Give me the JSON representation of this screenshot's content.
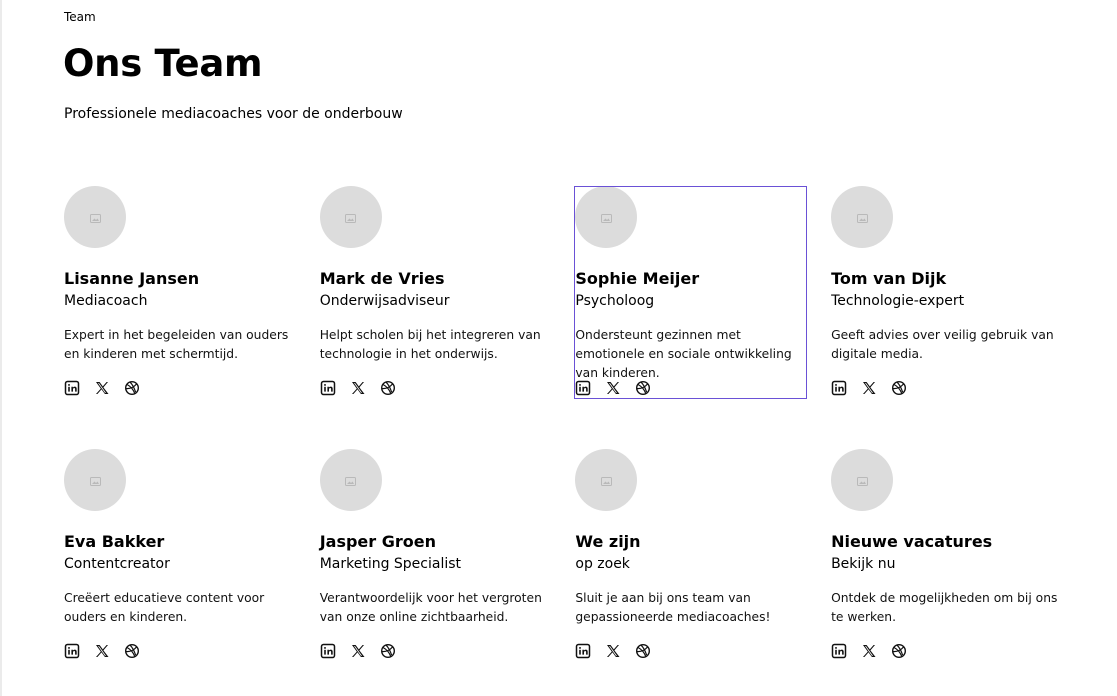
{
  "page": {
    "eyebrow": "Team",
    "title": "Ons Team",
    "subtitle": "Professionele mediacoaches voor de onderbouw"
  },
  "colors": {
    "avatar_bg": "#dcdcdc",
    "selection_outline": "#6a51d6"
  },
  "icons": {
    "avatar": "image-placeholder-icon",
    "socials": [
      "linkedin-icon",
      "x-icon",
      "dribbble-icon"
    ]
  },
  "members": [
    {
      "name": "Lisanne Jansen",
      "role": "Mediacoach",
      "bio": "Expert in het begeleiden van ouders en kinderen met schermtijd."
    },
    {
      "name": "Mark de Vries",
      "role": "Onderwijsadviseur",
      "bio": "Helpt scholen bij het integreren van technologie in het onderwijs."
    },
    {
      "name": "Sophie Meijer",
      "role": "Psycholoog",
      "bio": "Ondersteunt gezinnen met emotionele en sociale ontwikkeling van kinderen.",
      "selected": true
    },
    {
      "name": "Tom van Dijk",
      "role": "Technologie-expert",
      "bio": "Geeft advies over veilig gebruik van digitale media."
    },
    {
      "name": "Eva Bakker",
      "role": "Contentcreator",
      "bio": "Creëert educatieve content voor ouders en kinderen."
    },
    {
      "name": "Jasper Groen",
      "role": "Marketing Specialist",
      "bio": "Verantwoordelijk voor het vergroten van onze online zichtbaarheid."
    },
    {
      "name": "We zijn",
      "role": "op zoek",
      "bio": "Sluit je aan bij ons team van gepassioneerde mediacoaches!"
    },
    {
      "name": "Nieuwe vacatures",
      "role": "Bekijk nu",
      "bio": "Ontdek de mogelijkheden om bij ons te werken."
    }
  ]
}
